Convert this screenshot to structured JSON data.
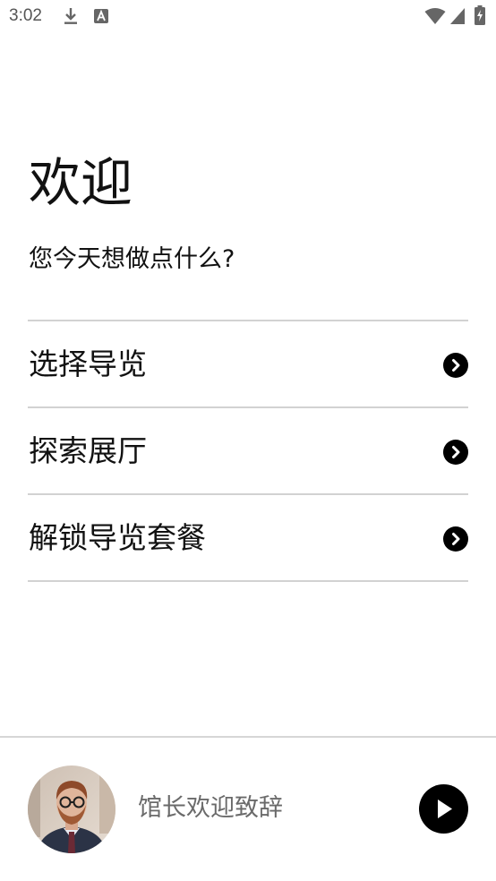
{
  "status_bar": {
    "time": "3:02",
    "icons": [
      "download-icon",
      "text-a-icon",
      "wifi-icon",
      "signal-icon",
      "battery-charging-icon"
    ]
  },
  "welcome": {
    "title": "欢迎",
    "subtitle": "您今天想做点什么?"
  },
  "menu": {
    "items": [
      {
        "label": "选择导览",
        "icon": "chevron-right-circle-icon"
      },
      {
        "label": "探索展厅",
        "icon": "chevron-right-circle-icon"
      },
      {
        "label": "解锁导览套餐",
        "icon": "chevron-right-circle-icon"
      }
    ]
  },
  "player": {
    "label": "馆长欢迎致辞",
    "play_icon": "play-icon",
    "avatar": "avatar"
  },
  "colors": {
    "text": "#111111",
    "divider": "#d2d2d2",
    "muted_text": "#6a6a6a",
    "play_button": "#000000"
  }
}
